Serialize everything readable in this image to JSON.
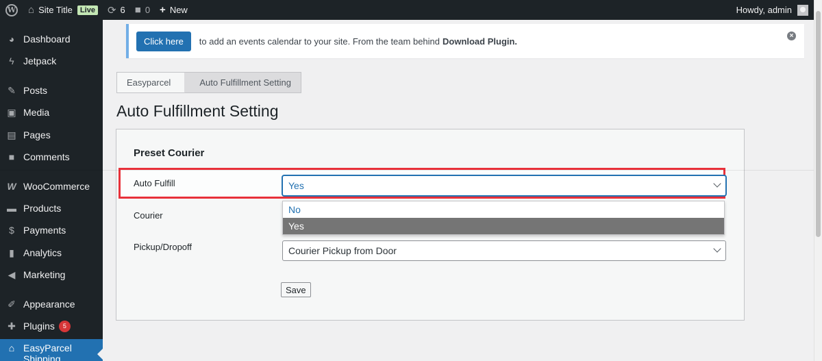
{
  "adminbar": {
    "site_title": "Site Title",
    "live_badge": "Live",
    "updates_count": "6",
    "comments_count": "0",
    "new_label": "New",
    "greeting": "Howdy, admin",
    "icons": [
      "wordpress-logo-icon",
      "home-icon",
      "refresh-icon",
      "comment-icon",
      "plus-icon",
      "avatar-icon"
    ]
  },
  "sidebar": {
    "items": [
      {
        "label": "Dashboard",
        "icon": "dashboard-icon"
      },
      {
        "label": "Jetpack",
        "icon": "jetpack-icon"
      },
      {
        "label": "Posts",
        "icon": "pin-icon"
      },
      {
        "label": "Media",
        "icon": "media-icon"
      },
      {
        "label": "Pages",
        "icon": "pages-icon"
      },
      {
        "label": "Comments",
        "icon": "comment-icon"
      },
      {
        "label": "WooCommerce",
        "icon": "woocommerce-icon"
      },
      {
        "label": "Products",
        "icon": "archive-icon"
      },
      {
        "label": "Payments",
        "icon": "payments-icon"
      },
      {
        "label": "Analytics",
        "icon": "chart-icon"
      },
      {
        "label": "Marketing",
        "icon": "megaphone-icon"
      },
      {
        "label": "Appearance",
        "icon": "brush-icon"
      },
      {
        "label": "Plugins",
        "icon": "plugin-icon",
        "badge": "5"
      },
      {
        "label": "EasyParcel Shipping",
        "icon": "store-icon"
      }
    ]
  },
  "notice": {
    "button_label": "Click here",
    "text": "to add an events calendar to your site. From the team behind",
    "strong_text": "Download Plugin."
  },
  "breadcrumbs": {
    "first": "Easyparcel",
    "current": "Auto Fulfillment Setting"
  },
  "page": {
    "title": "Auto Fulfillment Setting",
    "section_title": "Preset Courier",
    "fields": {
      "auto_fulfill_label": "Auto Fulfill",
      "auto_fulfill_value": "Yes",
      "auto_fulfill_options": [
        "No",
        "Yes"
      ],
      "courier_label": "Courier",
      "pickup_label": "Pickup/Dropoff",
      "pickup_value": "Courier Pickup from Door"
    },
    "save_label": "Save"
  },
  "colors": {
    "admin_dark": "#1d2327",
    "accent": "#2271b1",
    "highlight_border": "#e8313a",
    "badge_red": "#d63638"
  }
}
